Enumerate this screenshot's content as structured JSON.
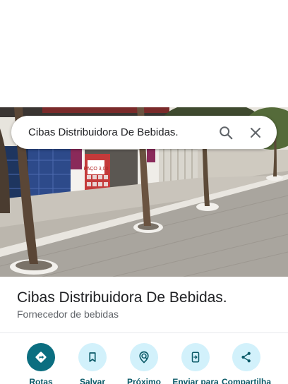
{
  "search": {
    "query": "Cibas Distribuidora De Bebidas."
  },
  "place": {
    "name": "Cibas Distribuidora De Bebidas.",
    "category": "Fornecedor de bebidas"
  },
  "storefront_sign": "PAÇO 3,00",
  "actions": [
    {
      "label": "Rotas",
      "icon": "directions-icon"
    },
    {
      "label": "Salvar",
      "icon": "bookmark-icon"
    },
    {
      "label": "Próximo",
      "icon": "nearby-icon"
    },
    {
      "label": "Enviar para",
      "icon": "send-to-phone-icon"
    },
    {
      "label": "Compartilha",
      "icon": "share-icon"
    }
  ],
  "colors": {
    "accent": "#0b6e80",
    "action_bg": "#d2f1fb",
    "action_text": "#0b5a68"
  }
}
